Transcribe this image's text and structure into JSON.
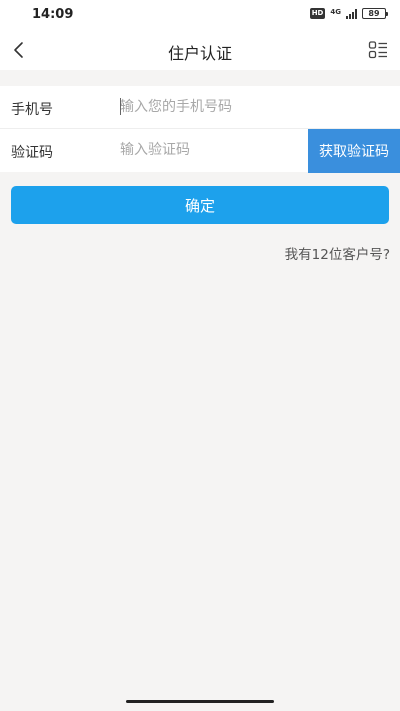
{
  "status_bar": {
    "time": "14:09",
    "hd_label": "HD",
    "network_label": "4G",
    "battery_level": "89"
  },
  "header": {
    "title": "住户认证",
    "back_icon": "chevron-left-icon",
    "menu_icon": "list-menu-icon"
  },
  "form": {
    "phone": {
      "label": "手机号",
      "value": "",
      "placeholder": "输入您的手机号码"
    },
    "code": {
      "label": "验证码",
      "value": "",
      "placeholder": "输入验证码"
    },
    "get_code_label": "获取验证码"
  },
  "confirm_label": "确定",
  "customer_number_link": "我有12位客户号?",
  "colors": {
    "accent": "#1da1ec",
    "code_button": "#3a8fdd",
    "background": "#f5f4f3"
  }
}
